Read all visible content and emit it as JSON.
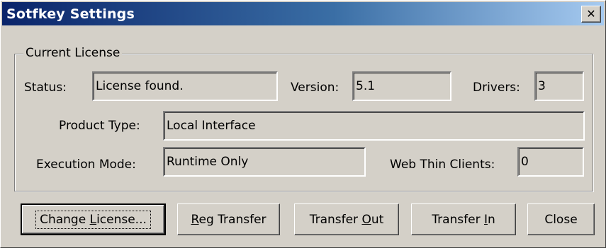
{
  "window": {
    "title": "Sotfkey Settings",
    "close_glyph": "✕"
  },
  "group": {
    "label": "Current License"
  },
  "fields": {
    "status": {
      "label": "Status:",
      "value": "License found."
    },
    "version": {
      "label": "Version:",
      "value": "5.1"
    },
    "drivers": {
      "label": "Drivers:",
      "value": "3"
    },
    "product_type": {
      "label": "Product Type:",
      "value": "Local Interface"
    },
    "execution_mode": {
      "label": "Execution Mode:",
      "value": "Runtime Only"
    },
    "web_thin_clients": {
      "label": "Web Thin Clients:",
      "value": "0"
    }
  },
  "buttons": {
    "change_license": {
      "pre": "Change ",
      "key": "L",
      "post": "icense..."
    },
    "reg_transfer": {
      "pre": "",
      "key": "R",
      "post": "eg Transfer"
    },
    "transfer_out": {
      "pre": "Transfer ",
      "key": "O",
      "post": "ut"
    },
    "transfer_in": {
      "pre": "Transfer ",
      "key": "I",
      "post": "n"
    },
    "close": {
      "label": "Close"
    }
  }
}
